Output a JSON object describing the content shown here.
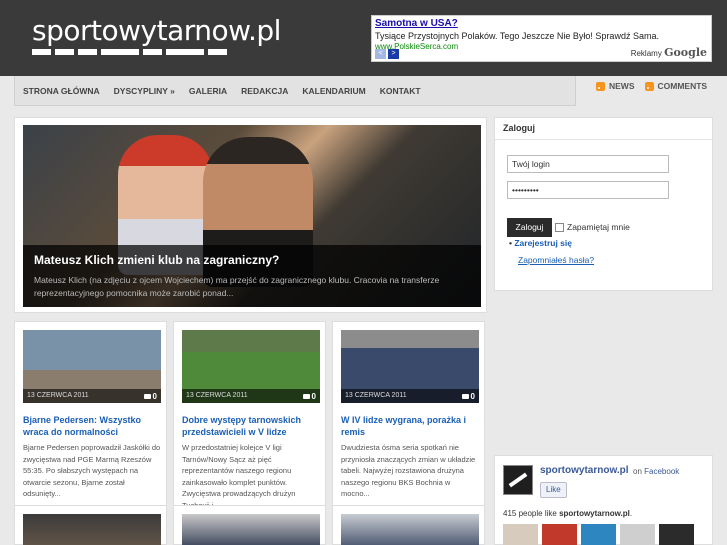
{
  "site": {
    "logo_text": "sportowytarnow.pl"
  },
  "ad": {
    "title": "Samotna w USA?",
    "text": "Tysiące Przystojnych Polaków. Tego Jeszcze Nie Było! Sprawdź Sama.",
    "url": "www.PolskieSerca.com",
    "brand_prefix": "Reklamy",
    "brand": "Google",
    "prev": "<",
    "next": ">"
  },
  "nav": {
    "items": [
      "STRONA GŁÓWNA",
      "DYSCYPLINY »",
      "GALERIA",
      "REDAKCJA",
      "KALENDARIUM",
      "KONTAKT"
    ]
  },
  "feeds": {
    "news": "NEWS",
    "comments": "COMMENTS"
  },
  "featured": {
    "title": "Mateusz Klich zmieni klub na zagraniczny?",
    "desc": "Mateusz Klich (na zdjęciu z ojcem Wojciechem) ma przejść do zagranicznego klubu. Cracovia na transferze reprezentacyjnego pomocnika może zarobić ponad..."
  },
  "articles": [
    {
      "date": "13 CZERWCA 2011",
      "comments": "0",
      "title": "Bjarne Pedersen: Wszystko wraca do normalności",
      "excerpt": "Bjarne Pedersen poprowadził Jaskółki do zwycięstwa nad PGE Marmą Rzeszów 55:35. Po słabszych występach na otwarcie sezonu, Bjarne został odsunięty..."
    },
    {
      "date": "13 CZERWCA 2011",
      "comments": "0",
      "title": "Dobre występy tarnowskich przedstawicieli w V lidze",
      "excerpt": "W przedostatniej kolejce V ligi Tarnów/Nowy Sącz aż pięć reprezentantów naszego regionu zainkasowało komplet punktów. Zwycięstwa prowadzących drużyn Tuchovii i..."
    },
    {
      "date": "13 CZERWCA 2011",
      "comments": "0",
      "title": "W IV lidze wygrana, porażka i remis",
      "excerpt": "Dwudziesta ósma seria spotkań nie przyniosła znaczących zmian w układzie tabeli. Najwyżej rozstawiona drużyna naszego regionu BKS Bochnia w mocno..."
    }
  ],
  "login": {
    "heading": "Zaloguj",
    "login_value": "Twój login",
    "password_value": "•••••••••",
    "submit": "Zaloguj",
    "remember": "Zapamiętaj mnie",
    "register": "Zarejestruj się",
    "forgot": "Zapomniałeś hasła?"
  },
  "facebook": {
    "page_name": "sportowytarnow.pl",
    "on_text": "on",
    "on_link": "Facebook",
    "like": "Like",
    "count_prefix": "415 people like",
    "count_page": "sportowytarnow.pl",
    "count_suffix": "."
  }
}
